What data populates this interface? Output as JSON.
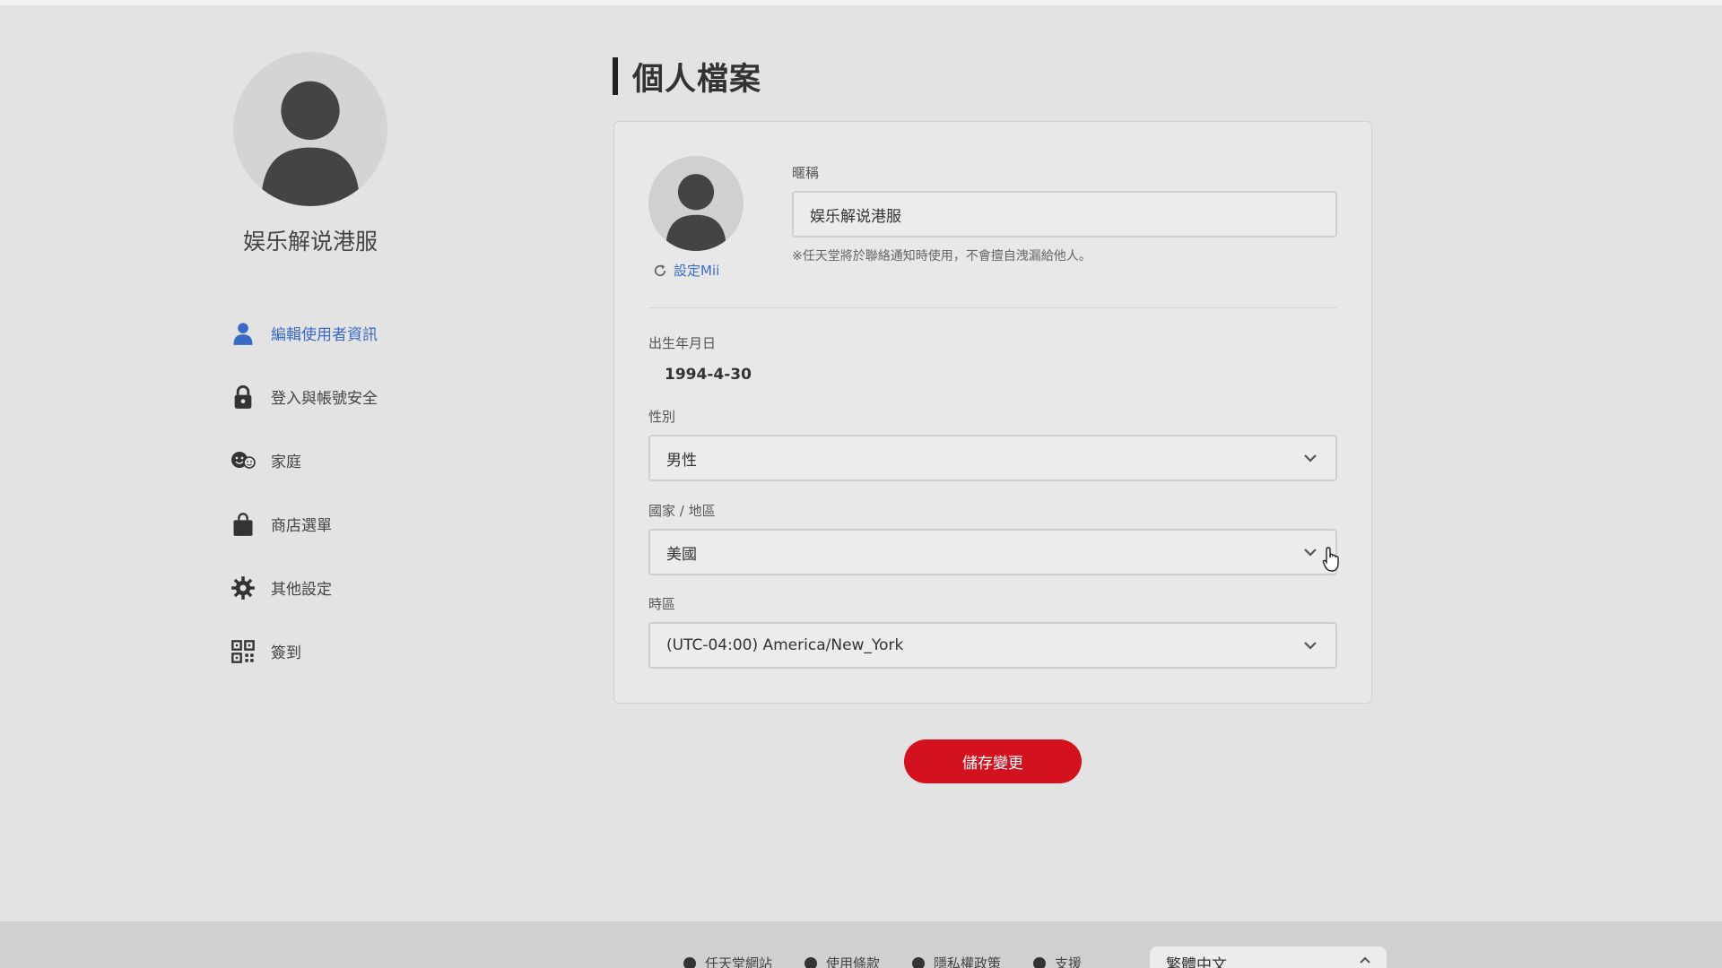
{
  "sidebar": {
    "username": "娱乐解说港服",
    "items": [
      {
        "label": "編輯使用者資訊",
        "icon": "user-icon",
        "active": true
      },
      {
        "label": "登入與帳號安全",
        "icon": "lock-icon",
        "active": false
      },
      {
        "label": "家庭",
        "icon": "family-icon",
        "active": false
      },
      {
        "label": "商店選單",
        "icon": "shopping-bag-icon",
        "active": false
      },
      {
        "label": "其他設定",
        "icon": "gear-icon",
        "active": false
      },
      {
        "label": "簽到",
        "icon": "qr-code-icon",
        "active": false
      }
    ]
  },
  "main": {
    "title": "個人檔案",
    "mii_link": "設定Mii",
    "nickname": {
      "label": "暱稱",
      "value": "娱乐解说港服",
      "note": "※任天堂將於聯絡通知時使用，不會擅自洩漏給他人。"
    },
    "dob": {
      "label": "出生年月日",
      "value": "1994-4-30"
    },
    "gender": {
      "label": "性別",
      "value": "男性"
    },
    "country": {
      "label": "國家 / 地區",
      "value": "美國"
    },
    "timezone": {
      "label": "時區",
      "value": "(UTC-04:00) America/New_York"
    },
    "save_label": "儲存變更"
  },
  "footer": {
    "links": [
      "任天堂網站",
      "使用條款",
      "隱私權政策",
      "支援"
    ],
    "language": "繁體中文"
  },
  "colors": {
    "accent": "#3a6bc4",
    "save_button": "#d3111f",
    "background": "#e3e3e3"
  }
}
